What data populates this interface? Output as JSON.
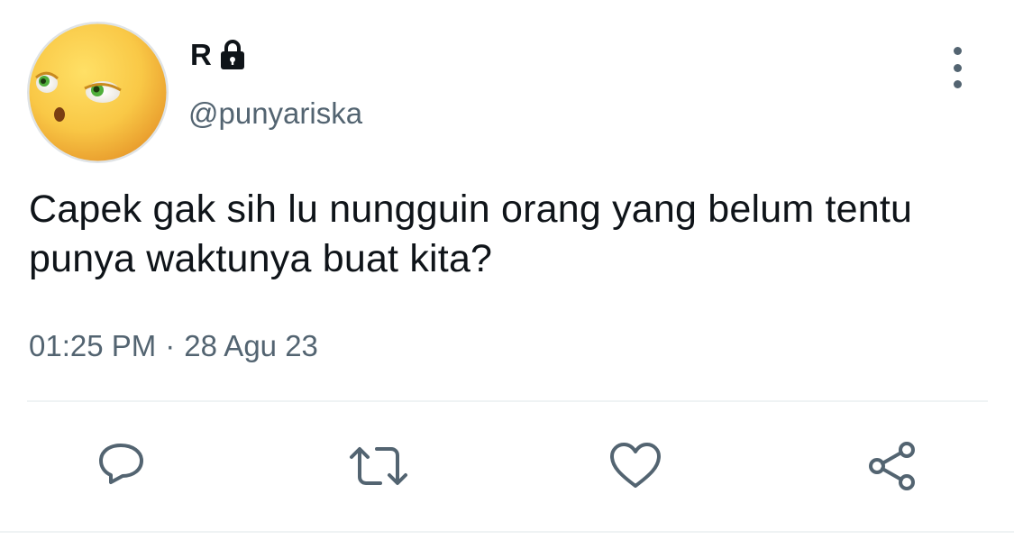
{
  "author": {
    "display_name": "R",
    "handle": "@punyariska",
    "protected": true
  },
  "icons": {
    "avatar": "rolling-eyes-emoji-avatar",
    "lock": "lock-icon",
    "more": "more-vertical-icon",
    "reply": "reply-icon",
    "retweet": "retweet-icon",
    "like": "heart-icon",
    "share": "share-icon"
  },
  "tweet": {
    "text": "Capek gak sih lu nungguin orang yang belum tentu punya waktunya buat kita?",
    "time": "01:25 PM",
    "separator": "·",
    "date": "28 Agu 23"
  },
  "colors": {
    "text": "#0f1419",
    "secondary": "#536471",
    "divider": "#eff3f4"
  }
}
